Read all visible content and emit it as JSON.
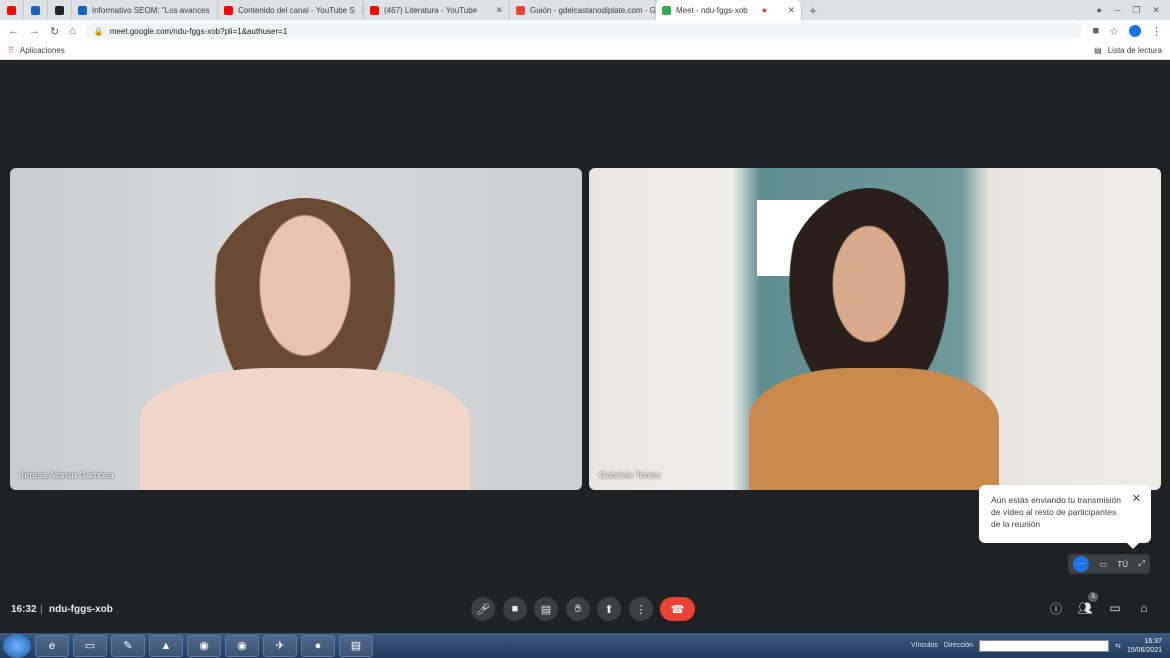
{
  "browser": {
    "tabs": [
      {
        "title": "",
        "color": "#ff0000"
      },
      {
        "title": "",
        "color": "#1565c0"
      },
      {
        "title": "",
        "color": "#222222"
      },
      {
        "title": "Informativo SEOM: \"Los avances",
        "color": "#1565c0"
      },
      {
        "title": "Contenido del canal - YouTube S",
        "color": "#ff0000"
      },
      {
        "title": "(467) Literatura - YouTube",
        "color": "#ff0000"
      },
      {
        "title": "Guión - gdelcastanodiplate.com - G",
        "color": "#ea4335"
      },
      {
        "title": "Meet - ndu-fggs-xob",
        "color": "#34a853",
        "active": true
      }
    ],
    "new_tab": "+",
    "url": "meet.google.com/ndu-fggs-xob?pli=1&authuser=1",
    "bookmarks_apps": "Aplicaciones",
    "reading_list": "Lista de lectura"
  },
  "tiles": [
    {
      "name": "Teresa Alonso Garbosa"
    },
    {
      "name": "Gabriela Torres"
    }
  ],
  "notice": {
    "text": "Aún estás enviando tu transmisión de vídeo al resto de participantes de la reunión",
    "close": "✕"
  },
  "self_view": {
    "label": "TÚ"
  },
  "meeting": {
    "time": "16:32",
    "separator": "|",
    "code": "ndu-fggs-xob",
    "participants_count": "3"
  },
  "taskbar": {
    "links_label": "Vínculos",
    "address_label": "Dirección",
    "time": "16:37",
    "date": "15/06/2021"
  }
}
